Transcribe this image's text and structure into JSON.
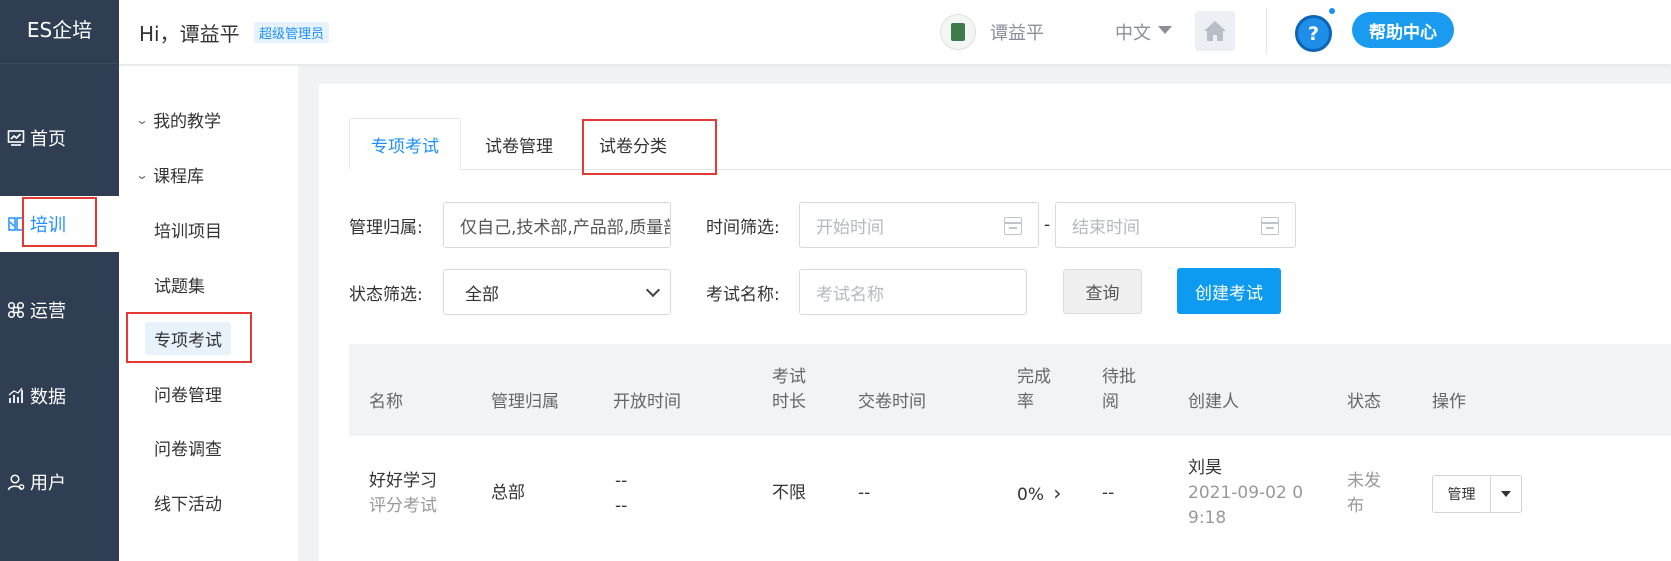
{
  "app": {
    "logo": "ES企培"
  },
  "leftnav": {
    "items": [
      {
        "key": "home",
        "label": "首页",
        "icon": "dashboard-icon"
      },
      {
        "key": "training",
        "label": "培训",
        "icon": "training-icon",
        "active": true
      },
      {
        "key": "operations",
        "label": "运营",
        "icon": "command-icon"
      },
      {
        "key": "data",
        "label": "数据",
        "icon": "bar-chart-icon"
      },
      {
        "key": "users",
        "label": "用户",
        "icon": "user-icon"
      }
    ]
  },
  "subnav": {
    "groups": [
      "我的教学",
      "课程库"
    ],
    "items": [
      "培训项目",
      "试题集",
      "专项考试",
      "问卷管理",
      "问卷调查",
      "线下活动"
    ]
  },
  "header": {
    "greeting": "Hi，谭益平",
    "role": "超级管理员",
    "username": "谭益平",
    "language": "中文",
    "help": "帮助中心",
    "help_icon_glyph": "?"
  },
  "tabs": [
    "专项考试",
    "试卷管理",
    "试卷分类"
  ],
  "filters": {
    "owner_label": "管理归属:",
    "owner_value": "仅自己,技术部,产品部,质量部",
    "time_label": "时间筛选:",
    "start_placeholder": "开始时间",
    "range_sep": "-",
    "end_placeholder": "结束时间",
    "status_label": "状态筛选:",
    "status_value": "全部",
    "name_label": "考试名称:",
    "name_placeholder": "考试名称",
    "query_btn": "查询",
    "create_btn": "创建考试"
  },
  "table": {
    "headers": {
      "name": "名称",
      "owner": "管理归属",
      "open_time": "开放时间",
      "duration_1": "考试",
      "duration_2": "时长",
      "submit_time": "交卷时间",
      "completion_1": "完成",
      "completion_2": "率",
      "pending_1": "待批",
      "pending_2": "阅",
      "creator": "创建人",
      "status": "状态",
      "actions": "操作"
    },
    "row": {
      "name": "好好学习",
      "subtype": "评分考试",
      "owner": "总部",
      "open_1": "--",
      "open_2": "--",
      "duration": "不限",
      "submit": "--",
      "completion": "0%",
      "completion_arrow": "›",
      "pending": "--",
      "creator_name": "刘昊",
      "created_1": "2021-09-02 0",
      "created_2": "9:18",
      "status_1": "未发",
      "status_2": "布",
      "manage": "管理"
    }
  },
  "colors": {
    "accent": "#1e90ff",
    "nav_bg": "#2f3e52",
    "highlight_box": "#e53935",
    "create_btn": "#0d9bf2"
  }
}
